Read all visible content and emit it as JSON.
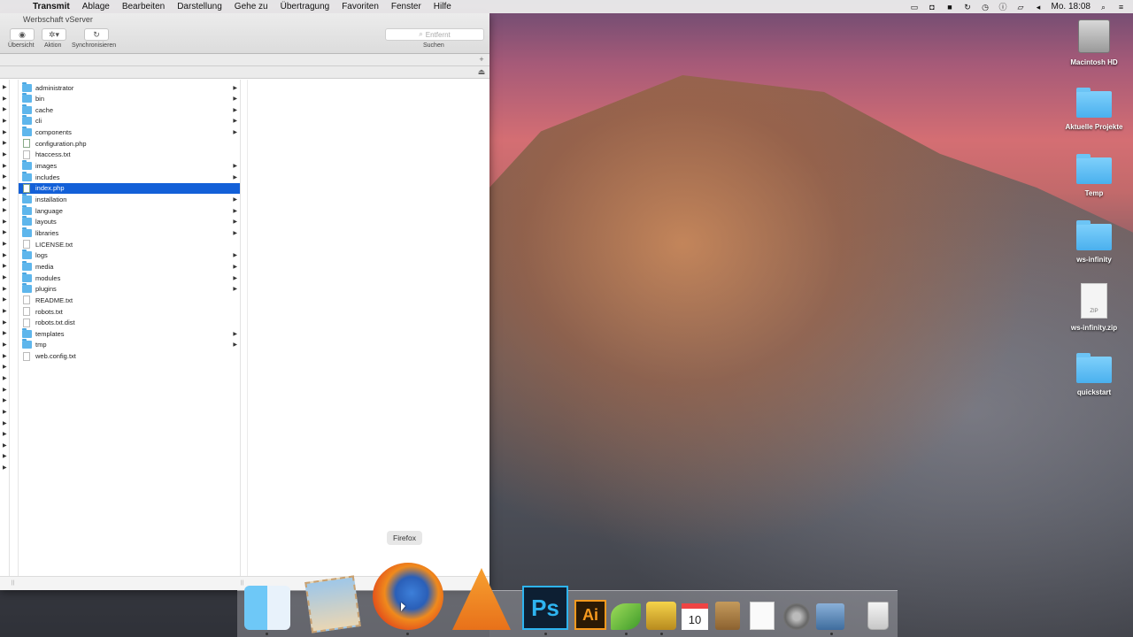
{
  "menubar": {
    "app": "Transmit",
    "items": [
      "Ablage",
      "Bearbeiten",
      "Darstellung",
      "Gehe zu",
      "Übertragung",
      "Favoriten",
      "Fenster",
      "Hilfe"
    ],
    "clock": "Mo. 18:08"
  },
  "window": {
    "title": "Werbschaft vServer",
    "toolbar": {
      "overview_label": "Übersicht",
      "action_label": "Aktion",
      "sync_label": "Synchronisieren",
      "search_placeholder": "Entfernt",
      "search_label": "Suchen"
    },
    "files": [
      {
        "name": "administrator",
        "type": "folder"
      },
      {
        "name": "bin",
        "type": "folder"
      },
      {
        "name": "cache",
        "type": "folder"
      },
      {
        "name": "cli",
        "type": "folder"
      },
      {
        "name": "components",
        "type": "folder"
      },
      {
        "name": "configuration.php",
        "type": "php"
      },
      {
        "name": "htaccess.txt",
        "type": "doc"
      },
      {
        "name": "images",
        "type": "folder"
      },
      {
        "name": "includes",
        "type": "folder"
      },
      {
        "name": "index.php",
        "type": "php",
        "selected": true
      },
      {
        "name": "installation",
        "type": "folder"
      },
      {
        "name": "language",
        "type": "folder"
      },
      {
        "name": "layouts",
        "type": "folder"
      },
      {
        "name": "libraries",
        "type": "folder"
      },
      {
        "name": "LICENSE.txt",
        "type": "doc"
      },
      {
        "name": "logs",
        "type": "folder"
      },
      {
        "name": "media",
        "type": "folder"
      },
      {
        "name": "modules",
        "type": "folder"
      },
      {
        "name": "plugins",
        "type": "folder"
      },
      {
        "name": "README.txt",
        "type": "doc"
      },
      {
        "name": "robots.txt",
        "type": "doc"
      },
      {
        "name": "robots.txt.dist",
        "type": "doc"
      },
      {
        "name": "templates",
        "type": "folder"
      },
      {
        "name": "tmp",
        "type": "folder"
      },
      {
        "name": "web.config.txt",
        "type": "doc"
      }
    ]
  },
  "desktop": {
    "items": [
      {
        "label": "Macintosh HD",
        "icon": "hard-drive-icon"
      },
      {
        "label": "Aktuelle Projekte",
        "icon": "folder-icon"
      },
      {
        "label": "Temp",
        "icon": "folder-icon"
      },
      {
        "label": "ws-infinity",
        "icon": "folder-icon"
      },
      {
        "label": "ws-infinity.zip",
        "icon": "zip-file-icon",
        "badge": "ZIP"
      },
      {
        "label": "quickstart",
        "icon": "folder-icon"
      }
    ]
  },
  "dock": {
    "tooltip": "Firefox",
    "photoshop_label": "Ps",
    "illustrator_label": "Ai",
    "calendar_day": "10",
    "apps": [
      "finder-icon",
      "mail-icon",
      "firefox-icon",
      "vlc-icon",
      "photoshop-icon",
      "illustrator-icon",
      "leaf-icon",
      "transmit-truck-icon",
      "calendar-icon",
      "contacts-icon",
      "reminders-icon",
      "system-preferences-icon",
      "preview-icon",
      "trash-icon"
    ]
  }
}
